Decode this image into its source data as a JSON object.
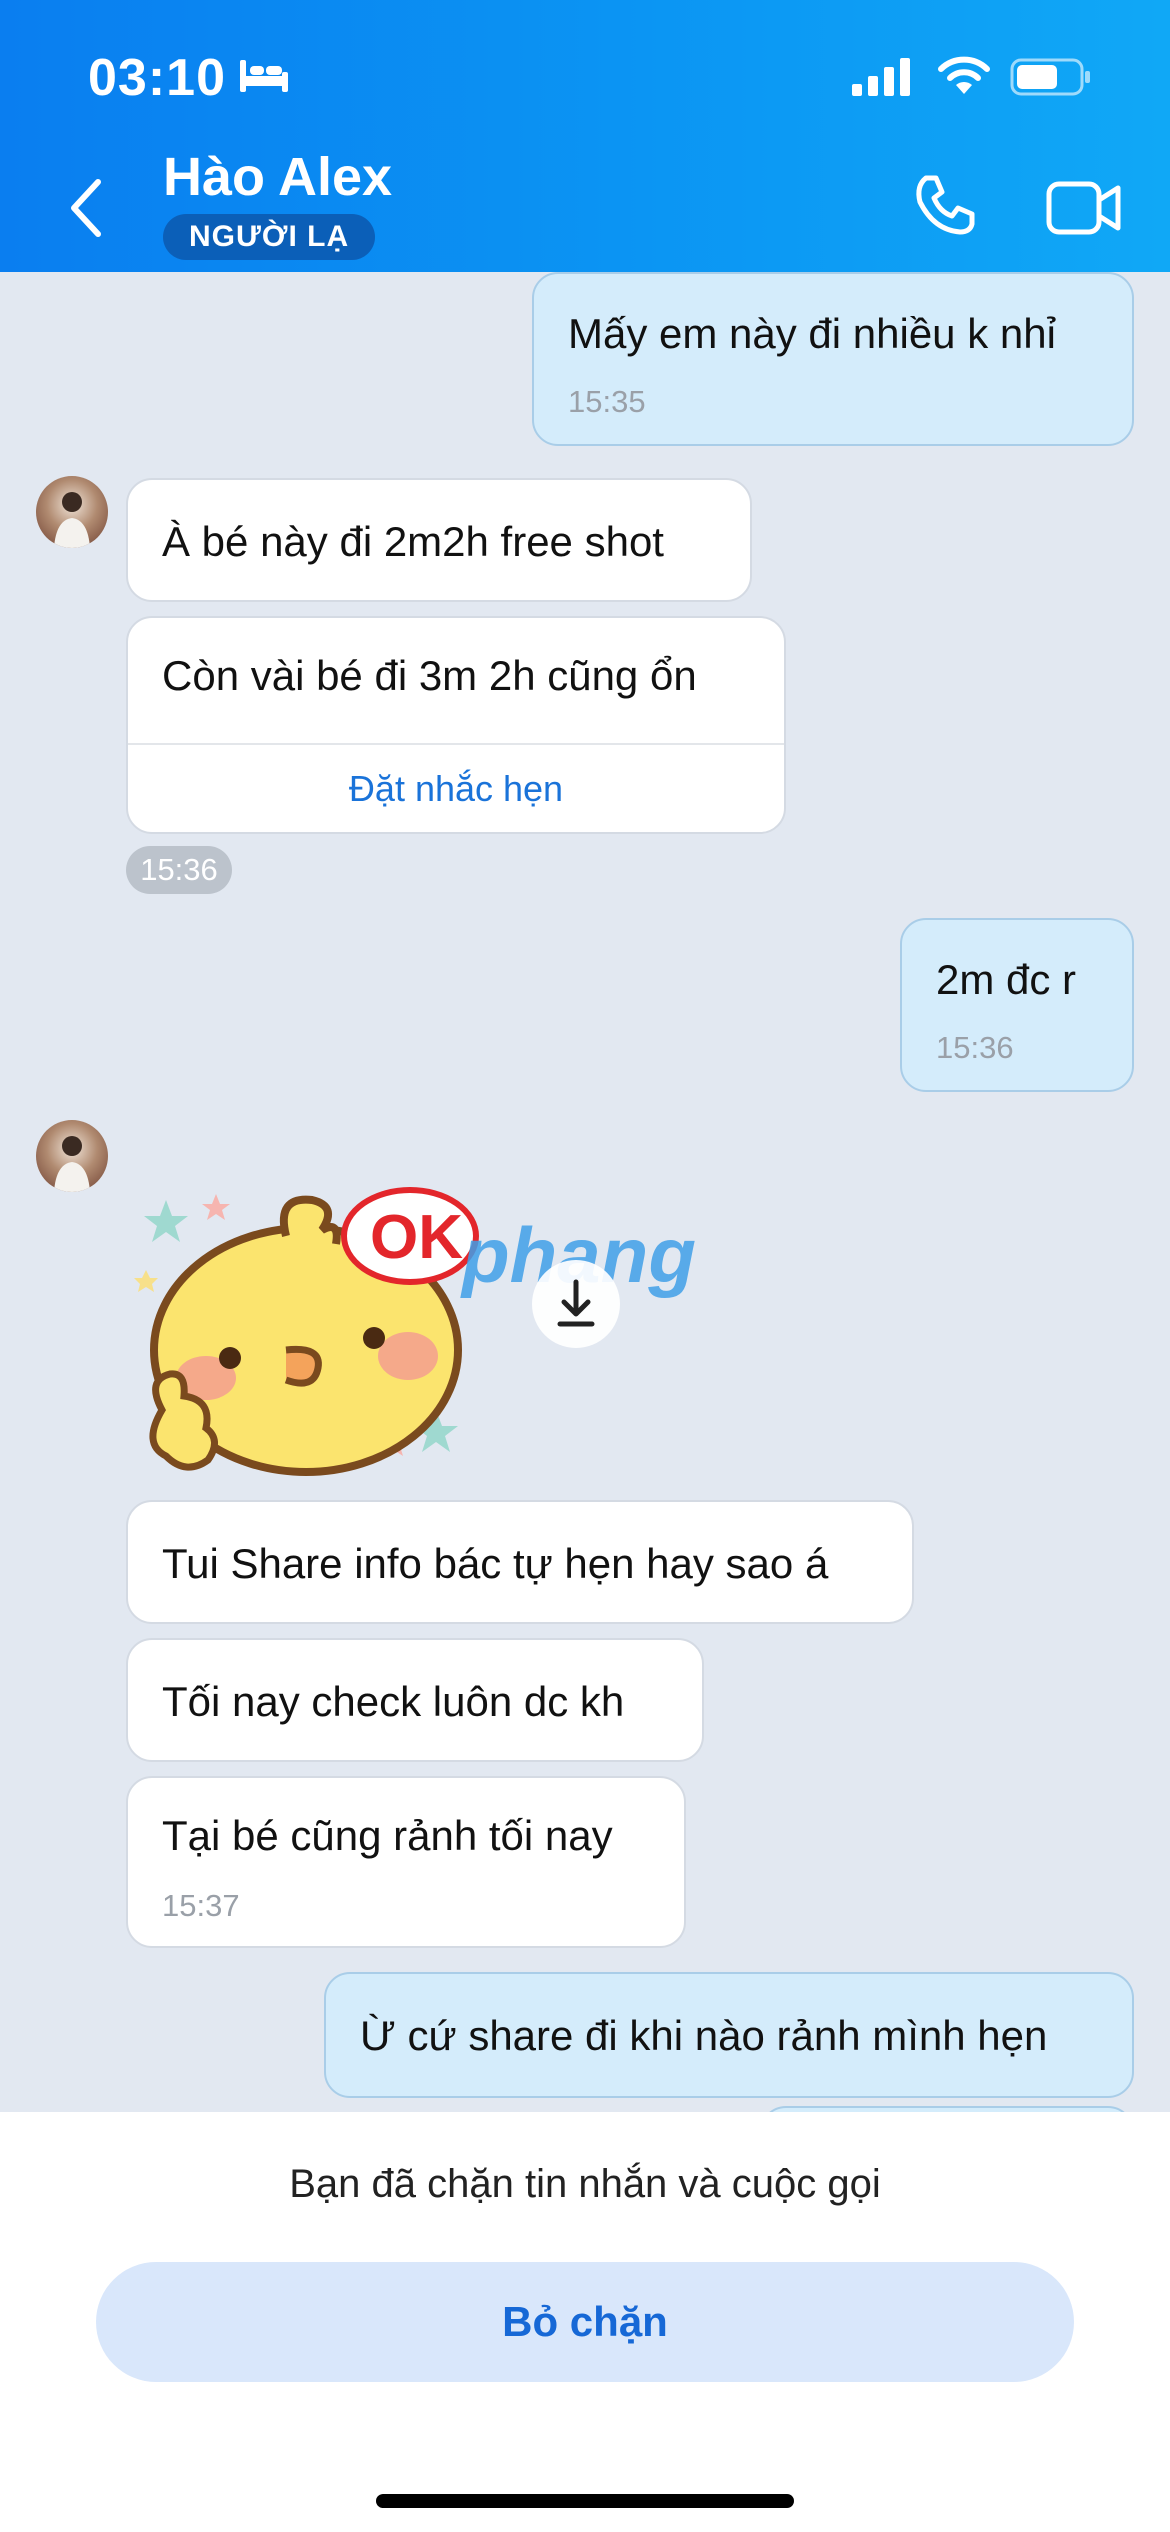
{
  "status_bar": {
    "time": "03:10"
  },
  "header": {
    "contact_name": "Hào Alex",
    "badge": "NGƯỜI LẠ"
  },
  "messages": [
    {
      "from": "me",
      "text": "Mấy em này đi nhiều k nhỉ",
      "time": "15:35"
    },
    {
      "from": "them",
      "text": "À bé này đi 2m2h free shot"
    },
    {
      "from": "them",
      "text": "Còn vài bé đi 3m 2h cũng ổn",
      "action": "Đặt nhắc hẹn"
    },
    {
      "from": "them",
      "time_pill": "15:36"
    },
    {
      "from": "me",
      "text": "2m đc r",
      "time": "15:36"
    },
    {
      "from": "them",
      "sticker": "ok-chick-sticker",
      "watermark": "phang"
    },
    {
      "from": "them",
      "text": "Tui Share info bác tự hẹn hay sao á"
    },
    {
      "from": "them",
      "text": "Tối nay check luôn dc kh"
    },
    {
      "from": "them",
      "text": "Tại bé cũng rảnh tối nay",
      "time": "15:37"
    },
    {
      "from": "me",
      "text": "Ừ cứ share đi khi nào rảnh mình hẹn"
    }
  ],
  "bottom_sheet": {
    "notice": "Bạn đã chặn tin nhắn và cuộc gọi",
    "unblock_label": "Bỏ chặn"
  },
  "icons": {
    "back": "chevron-left-icon",
    "call": "phone-icon",
    "video": "video-camera-icon",
    "download": "download-icon"
  },
  "colors": {
    "header": "#0a8cf2",
    "chat_background": "#e2e8f1",
    "outgoing_bubble": "#d4ecfb",
    "incoming_bubble": "#ffffff",
    "link": "#1a73d9"
  }
}
